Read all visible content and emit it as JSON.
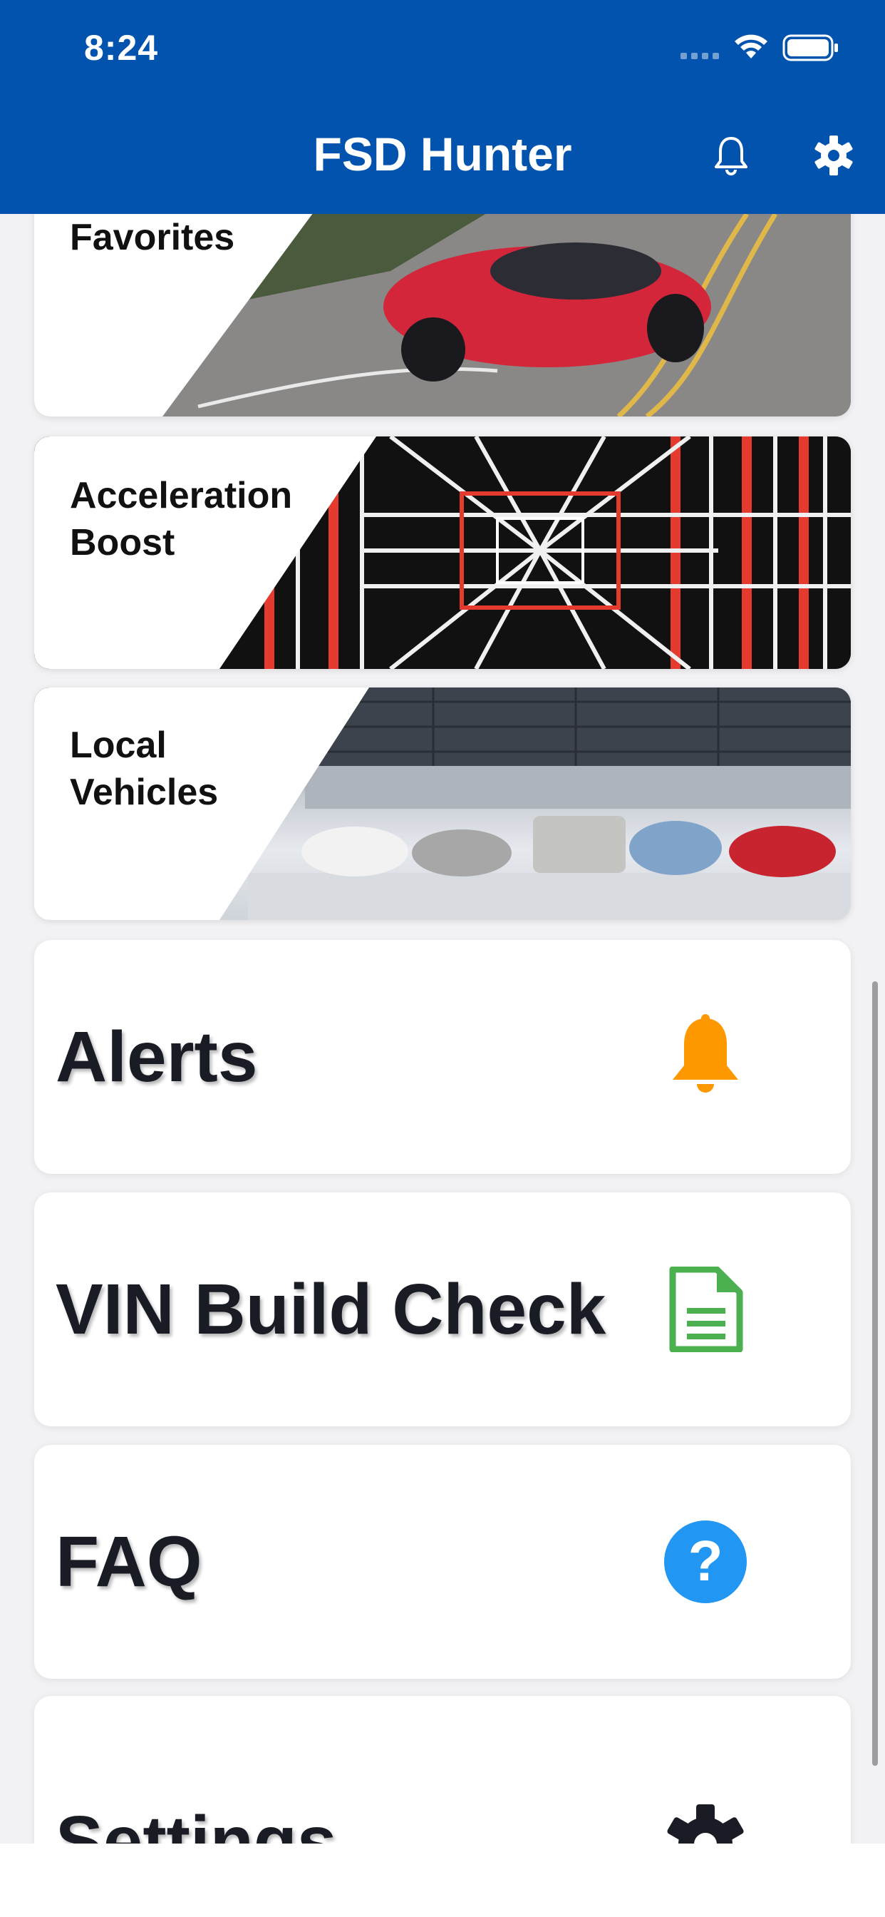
{
  "status_bar": {
    "time": "8:24"
  },
  "header": {
    "title": "FSD Hunter",
    "bell_icon": "bell-outline-icon",
    "gear_icon": "gear-icon",
    "background": "#0253ad"
  },
  "image_cards": [
    {
      "label": "Favorites",
      "image": "red-roadster-road-photo"
    },
    {
      "label_line1": "Acceleration",
      "label_line2": "Boost",
      "image": "red-white-light-tunnel"
    },
    {
      "label_line1": "Local",
      "label_line2": "Vehicles",
      "image": "cars-under-solar-canopy"
    }
  ],
  "menu": [
    {
      "label": "Alerts",
      "icon": "bell-icon",
      "color": "#fe9800"
    },
    {
      "label": "VIN Build Check",
      "icon": "document-icon",
      "color": "#4caf50"
    },
    {
      "label": "FAQ",
      "icon": "question-icon",
      "color": "#2196f3"
    },
    {
      "label": "Settings",
      "icon": "gear-icon",
      "color": "#1a1c25"
    }
  ]
}
